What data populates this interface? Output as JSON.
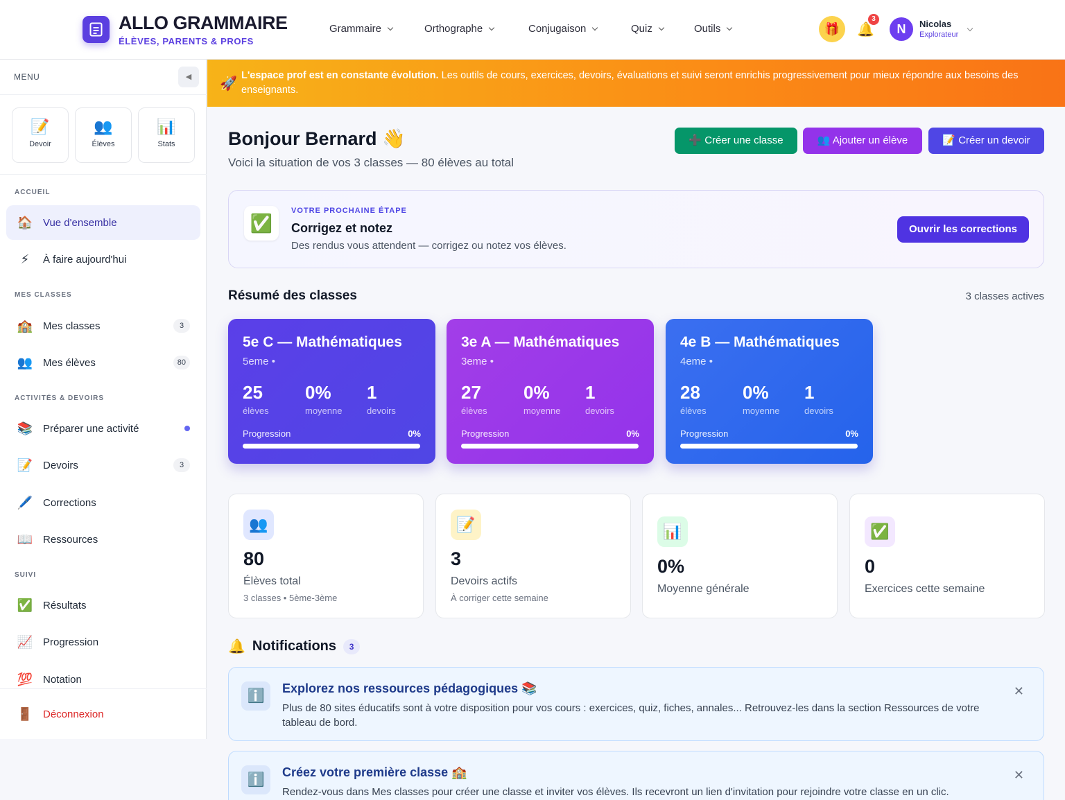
{
  "header": {
    "brand_title": "ALLO GRAMMAIRE",
    "brand_sub": "ÉLÈVES, PARENTS & PROFS",
    "nav": [
      "Grammaire",
      "Orthographe",
      "Conjugaison",
      "Quiz",
      "Outils"
    ],
    "gift_icon": "🎁",
    "bell_icon": "🔔",
    "bell_count": "3",
    "avatar_initial": "N",
    "user_name": "Nicolas",
    "user_role": "Explorateur"
  },
  "sidebar": {
    "menu_title": "MENU",
    "collapse_icon": "◀",
    "quick": [
      {
        "icon": "📝",
        "label": "Devoir"
      },
      {
        "icon": "👥",
        "label": "Élèves"
      },
      {
        "icon": "📊",
        "label": "Stats"
      }
    ],
    "sections": {
      "accueil": "ACCUEIL",
      "classes": "MES CLASSES",
      "activites": "ACTIVITÉS & DEVOIRS",
      "suivi": "SUIVI"
    },
    "items": [
      {
        "icon": "🏠",
        "label": "Vue d'ensemble"
      },
      {
        "icon": "⚡",
        "label": "À faire aujourd'hui"
      },
      {
        "icon": "🏫",
        "label": "Mes classes",
        "count": "3"
      },
      {
        "icon": "👥",
        "label": "Mes élèves",
        "count": "80"
      },
      {
        "icon": "📚",
        "label": "Préparer une activité"
      },
      {
        "icon": "📝",
        "label": "Devoirs",
        "count": "3"
      },
      {
        "icon": "🖊️",
        "label": "Corrections"
      },
      {
        "icon": "📖",
        "label": "Ressources"
      },
      {
        "icon": "✅",
        "label": "Résultats"
      },
      {
        "icon": "📈",
        "label": "Progression"
      },
      {
        "icon": "💯",
        "label": "Notation"
      },
      {
        "icon": "🚪",
        "label": "Déconnexion"
      }
    ]
  },
  "banner": {
    "icon": "🚀",
    "bold": "L'espace prof est en constante évolution.",
    "text": " Les outils de cours, exercices, devoirs, évaluations et suivi seront enrichis progressivement pour mieux répondre aux besoins des enseignants."
  },
  "main": {
    "greeting": "Bonjour Bernard 👋",
    "greeting_sub": "Voici la situation de vos 3 classes — 80 élèves au total",
    "buttons": {
      "create_class": "➕ Créer une classe",
      "add_student": "👥 Ajouter un élève",
      "create_homework": "📝 Créer un devoir"
    },
    "next_step": {
      "icon": "✅",
      "kicker": "VOTRE PROCHAINE ÉTAPE",
      "title": "Corrigez et notez",
      "desc": "Des rendus vous attendent — corrigez ou notez vos élèves.",
      "button": "Ouvrir les corrections"
    },
    "summary_title": "Résumé des classes",
    "summary_right": "3 classes actives",
    "classes": [
      {
        "title": "5e C — Mathématiques",
        "level": "5eme •",
        "students": "25",
        "students_label": "élèves",
        "avg": "0%",
        "avg_label": "moyenne",
        "homework": "1",
        "homework_label": "devoirs",
        "progress_label": "Progression",
        "progress": "0%"
      },
      {
        "title": "3e A — Mathématiques",
        "level": "3eme •",
        "students": "27",
        "students_label": "élèves",
        "avg": "0%",
        "avg_label": "moyenne",
        "homework": "1",
        "homework_label": "devoirs",
        "progress_label": "Progression",
        "progress": "0%"
      },
      {
        "title": "4e B — Mathématiques",
        "level": "4eme •",
        "students": "28",
        "students_label": "élèves",
        "avg": "0%",
        "avg_label": "moyenne",
        "homework": "1",
        "homework_label": "devoirs",
        "progress_label": "Progression",
        "progress": "0%"
      }
    ],
    "stats": [
      {
        "icon": "👥",
        "value": "80",
        "label": "Élèves total",
        "sub": "3 classes • 5ème-3ème"
      },
      {
        "icon": "📝",
        "value": "3",
        "label": "Devoirs actifs",
        "sub": "À corriger cette semaine"
      },
      {
        "icon": "📊",
        "value": "0%",
        "label": "Moyenne générale"
      },
      {
        "icon": "✅",
        "value": "0",
        "label": "Exercices cette semaine"
      }
    ],
    "notifications": {
      "icon": "🔔",
      "title": "Notifications",
      "count": "3",
      "items": [
        {
          "icon": "ℹ️",
          "title": "Explorez nos ressources pédagogiques 📚",
          "desc": "Plus de 80 sites éducatifs sont à votre disposition pour vos cours : exercices, quiz, fiches, annales... Retrouvez-les dans la section Ressources de votre tableau de bord.",
          "close": "✕"
        },
        {
          "icon": "ℹ️",
          "title": "Créez votre première classe 🏫",
          "desc": "Rendez-vous dans Mes classes pour créer une classe et inviter vos élèves. Ils recevront un lien d'invitation pour rejoindre votre classe en un clic.",
          "close": "✕"
        }
      ]
    }
  },
  "colors": {
    "accent": "#5b3fe0",
    "green": "#059669",
    "purple": "#9333ea",
    "indigo": "#4f46e5"
  }
}
